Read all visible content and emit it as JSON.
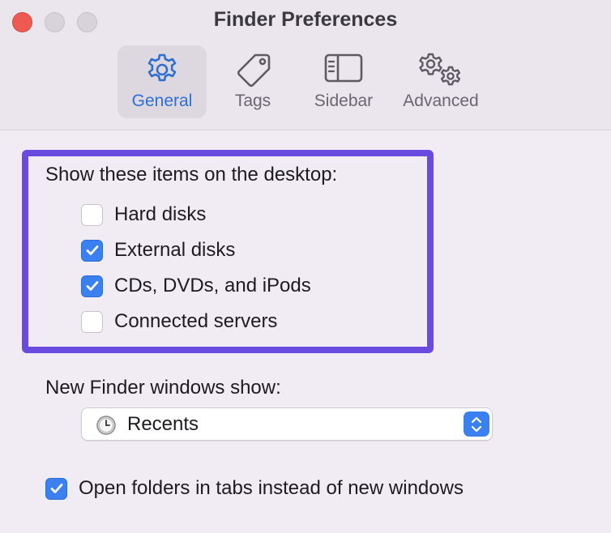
{
  "window": {
    "title": "Finder Preferences"
  },
  "tabs": [
    {
      "label": "General",
      "icon": "gear-icon",
      "selected": true
    },
    {
      "label": "Tags",
      "icon": "tag-icon",
      "selected": false
    },
    {
      "label": "Sidebar",
      "icon": "sidebar-icon",
      "selected": false
    },
    {
      "label": "Advanced",
      "icon": "gears-icon",
      "selected": false
    }
  ],
  "desktop": {
    "heading": "Show these items on the desktop:",
    "items": [
      {
        "label": "Hard disks",
        "checked": false
      },
      {
        "label": "External disks",
        "checked": true
      },
      {
        "label": "CDs, DVDs, and iPods",
        "checked": true
      },
      {
        "label": "Connected servers",
        "checked": false
      }
    ]
  },
  "new_windows": {
    "label": "New Finder windows show:",
    "selected": "Recents",
    "icon": "clock-icon"
  },
  "open_in_tabs": {
    "label": "Open folders in tabs instead of new windows",
    "checked": true
  },
  "colors": {
    "accent": "#3a80f0",
    "highlight": "#6a4be0",
    "close": "#ee5a52"
  }
}
